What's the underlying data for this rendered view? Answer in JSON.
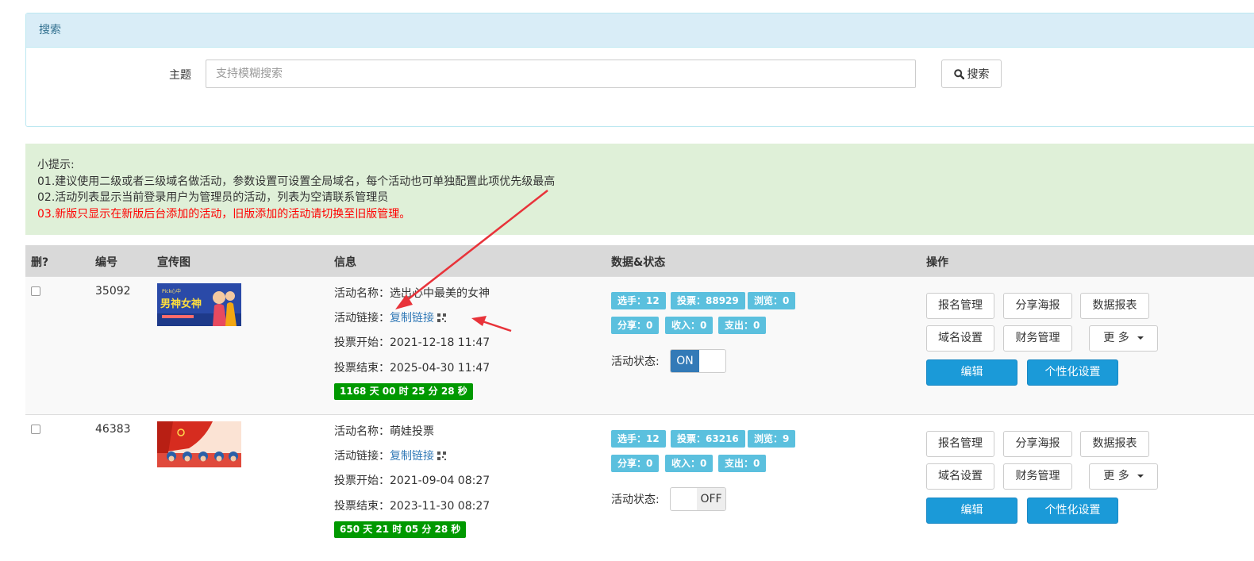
{
  "search": {
    "panel_title": "搜索",
    "field_label": "主题",
    "placeholder": "支持模糊搜索",
    "button_label": "搜索"
  },
  "tips": {
    "title": "小提示:",
    "line1": "01.建议使用二级或者三级域名做活动，参数设置可设置全局域名，每个活动也可单独配置此项优先级最高",
    "line2": "02.活动列表显示当前登录用户为管理员的活动，列表为空请联系管理员",
    "line3": "03.新版只显示在新版后台添加的活动，旧版添加的活动请切换至旧版管理。"
  },
  "table": {
    "headers": {
      "delete": "删?",
      "id": "编号",
      "banner": "宣传图",
      "info": "信息",
      "data_status": "数据&状态",
      "actions": "操作"
    },
    "rows": [
      {
        "id": "35092",
        "name_label": "活动名称：",
        "name": "选出心中最美的女神",
        "link_label": "活动链接：",
        "link_text": "复制链接",
        "start_label": "投票开始：",
        "start": "2021-12-18 11:47",
        "end_label": "投票结束：",
        "end": "2025-04-30 11:47",
        "countdown": "1168 天 00 时 25 分 28 秒",
        "badges": [
          "选手：12",
          "投票：88929",
          "浏览：0",
          "分享：0",
          "收入：0",
          "支出：0"
        ],
        "status_label": "活动状态:",
        "status": "ON"
      },
      {
        "id": "46383",
        "name_label": "活动名称：",
        "name": "萌娃投票",
        "link_label": "活动链接：",
        "link_text": "复制链接",
        "start_label": "投票开始：",
        "start": "2021-09-04 08:27",
        "end_label": "投票结束：",
        "end": "2023-11-30 08:27",
        "countdown": "650 天 21 时 05 分 28 秒",
        "badges": [
          "选手：12",
          "投票：63216",
          "浏览：9",
          "分享：0",
          "收入：0",
          "支出：0"
        ],
        "status_label": "活动状态:",
        "status": "OFF"
      }
    ],
    "action_buttons": {
      "signup": "报名管理",
      "poster": "分享海报",
      "report": "数据报表",
      "domain": "域名设置",
      "finance": "财务管理",
      "more": "更 多",
      "edit": "编辑",
      "custom": "个性化设置"
    }
  },
  "banner1_text": "男神女神",
  "banner1_small": "Pick心中",
  "colors": {
    "accent_blue": "#1b9ad8",
    "badge_cyan": "#5bc0de",
    "countdown_green": "#009900",
    "tip_red": "#ff0000",
    "annotation_arrow": "#e8333a"
  }
}
